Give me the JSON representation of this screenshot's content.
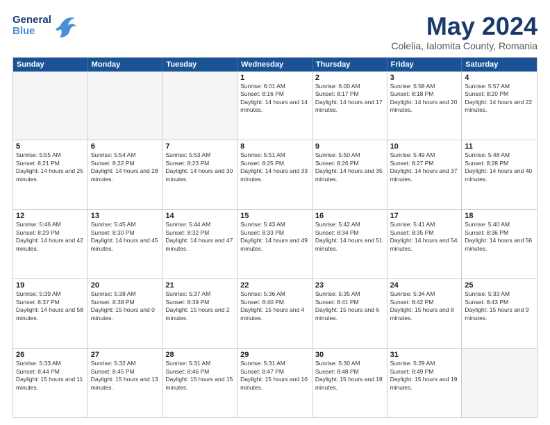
{
  "header": {
    "logo_line1": "General",
    "logo_line2": "Blue",
    "month_title": "May 2024",
    "subtitle": "Colelia, Ialomita County, Romania"
  },
  "weekdays": [
    "Sunday",
    "Monday",
    "Tuesday",
    "Wednesday",
    "Thursday",
    "Friday",
    "Saturday"
  ],
  "rows": [
    [
      {
        "day": "",
        "empty": true
      },
      {
        "day": "",
        "empty": true
      },
      {
        "day": "",
        "empty": true
      },
      {
        "day": "1",
        "sunrise": "Sunrise: 6:01 AM",
        "sunset": "Sunset: 8:16 PM",
        "daylight": "Daylight: 14 hours and 14 minutes."
      },
      {
        "day": "2",
        "sunrise": "Sunrise: 6:00 AM",
        "sunset": "Sunset: 8:17 PM",
        "daylight": "Daylight: 14 hours and 17 minutes."
      },
      {
        "day": "3",
        "sunrise": "Sunrise: 5:58 AM",
        "sunset": "Sunset: 8:18 PM",
        "daylight": "Daylight: 14 hours and 20 minutes."
      },
      {
        "day": "4",
        "sunrise": "Sunrise: 5:57 AM",
        "sunset": "Sunset: 8:20 PM",
        "daylight": "Daylight: 14 hours and 22 minutes."
      }
    ],
    [
      {
        "day": "5",
        "sunrise": "Sunrise: 5:55 AM",
        "sunset": "Sunset: 8:21 PM",
        "daylight": "Daylight: 14 hours and 25 minutes."
      },
      {
        "day": "6",
        "sunrise": "Sunrise: 5:54 AM",
        "sunset": "Sunset: 8:22 PM",
        "daylight": "Daylight: 14 hours and 28 minutes."
      },
      {
        "day": "7",
        "sunrise": "Sunrise: 5:53 AM",
        "sunset": "Sunset: 8:23 PM",
        "daylight": "Daylight: 14 hours and 30 minutes."
      },
      {
        "day": "8",
        "sunrise": "Sunrise: 5:51 AM",
        "sunset": "Sunset: 8:25 PM",
        "daylight": "Daylight: 14 hours and 33 minutes."
      },
      {
        "day": "9",
        "sunrise": "Sunrise: 5:50 AM",
        "sunset": "Sunset: 8:26 PM",
        "daylight": "Daylight: 14 hours and 35 minutes."
      },
      {
        "day": "10",
        "sunrise": "Sunrise: 5:49 AM",
        "sunset": "Sunset: 8:27 PM",
        "daylight": "Daylight: 14 hours and 37 minutes."
      },
      {
        "day": "11",
        "sunrise": "Sunrise: 5:48 AM",
        "sunset": "Sunset: 8:28 PM",
        "daylight": "Daylight: 14 hours and 40 minutes."
      }
    ],
    [
      {
        "day": "12",
        "sunrise": "Sunrise: 5:46 AM",
        "sunset": "Sunset: 8:29 PM",
        "daylight": "Daylight: 14 hours and 42 minutes."
      },
      {
        "day": "13",
        "sunrise": "Sunrise: 5:45 AM",
        "sunset": "Sunset: 8:30 PM",
        "daylight": "Daylight: 14 hours and 45 minutes."
      },
      {
        "day": "14",
        "sunrise": "Sunrise: 5:44 AM",
        "sunset": "Sunset: 8:32 PM",
        "daylight": "Daylight: 14 hours and 47 minutes."
      },
      {
        "day": "15",
        "sunrise": "Sunrise: 5:43 AM",
        "sunset": "Sunset: 8:33 PM",
        "daylight": "Daylight: 14 hours and 49 minutes."
      },
      {
        "day": "16",
        "sunrise": "Sunrise: 5:42 AM",
        "sunset": "Sunset: 8:34 PM",
        "daylight": "Daylight: 14 hours and 51 minutes."
      },
      {
        "day": "17",
        "sunrise": "Sunrise: 5:41 AM",
        "sunset": "Sunset: 8:35 PM",
        "daylight": "Daylight: 14 hours and 54 minutes."
      },
      {
        "day": "18",
        "sunrise": "Sunrise: 5:40 AM",
        "sunset": "Sunset: 8:36 PM",
        "daylight": "Daylight: 14 hours and 56 minutes."
      }
    ],
    [
      {
        "day": "19",
        "sunrise": "Sunrise: 5:39 AM",
        "sunset": "Sunset: 8:37 PM",
        "daylight": "Daylight: 14 hours and 58 minutes."
      },
      {
        "day": "20",
        "sunrise": "Sunrise: 5:38 AM",
        "sunset": "Sunset: 8:38 PM",
        "daylight": "Daylight: 15 hours and 0 minutes."
      },
      {
        "day": "21",
        "sunrise": "Sunrise: 5:37 AM",
        "sunset": "Sunset: 8:39 PM",
        "daylight": "Daylight: 15 hours and 2 minutes."
      },
      {
        "day": "22",
        "sunrise": "Sunrise: 5:36 AM",
        "sunset": "Sunset: 8:40 PM",
        "daylight": "Daylight: 15 hours and 4 minutes."
      },
      {
        "day": "23",
        "sunrise": "Sunrise: 5:35 AM",
        "sunset": "Sunset: 8:41 PM",
        "daylight": "Daylight: 15 hours and 6 minutes."
      },
      {
        "day": "24",
        "sunrise": "Sunrise: 5:34 AM",
        "sunset": "Sunset: 8:42 PM",
        "daylight": "Daylight: 15 hours and 8 minutes."
      },
      {
        "day": "25",
        "sunrise": "Sunrise: 5:33 AM",
        "sunset": "Sunset: 8:43 PM",
        "daylight": "Daylight: 15 hours and 9 minutes."
      }
    ],
    [
      {
        "day": "26",
        "sunrise": "Sunrise: 5:33 AM",
        "sunset": "Sunset: 8:44 PM",
        "daylight": "Daylight: 15 hours and 11 minutes."
      },
      {
        "day": "27",
        "sunrise": "Sunrise: 5:32 AM",
        "sunset": "Sunset: 8:45 PM",
        "daylight": "Daylight: 15 hours and 13 minutes."
      },
      {
        "day": "28",
        "sunrise": "Sunrise: 5:31 AM",
        "sunset": "Sunset: 8:46 PM",
        "daylight": "Daylight: 15 hours and 15 minutes."
      },
      {
        "day": "29",
        "sunrise": "Sunrise: 5:31 AM",
        "sunset": "Sunset: 8:47 PM",
        "daylight": "Daylight: 15 hours and 16 minutes."
      },
      {
        "day": "30",
        "sunrise": "Sunrise: 5:30 AM",
        "sunset": "Sunset: 8:48 PM",
        "daylight": "Daylight: 15 hours and 18 minutes."
      },
      {
        "day": "31",
        "sunrise": "Sunrise: 5:29 AM",
        "sunset": "Sunset: 8:49 PM",
        "daylight": "Daylight: 15 hours and 19 minutes."
      },
      {
        "day": "",
        "empty": true
      }
    ]
  ]
}
